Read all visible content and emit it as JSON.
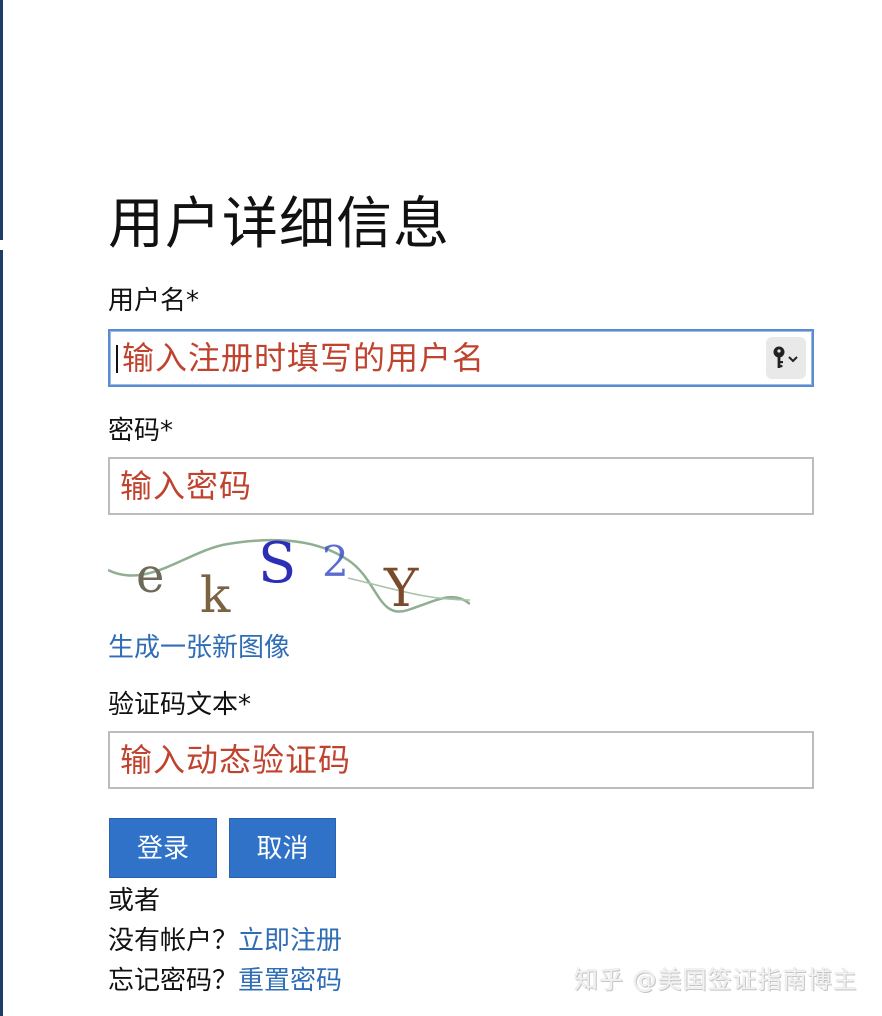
{
  "form": {
    "title": "用户详细信息",
    "username": {
      "label": "用户名*",
      "placeholder": "输入注册时填写的用户名"
    },
    "password": {
      "label": "密码*",
      "placeholder": "输入密码"
    },
    "captcha": {
      "image_text": [
        "e",
        "k",
        "S",
        "2",
        "Y"
      ],
      "refresh_link": "生成一张新图像",
      "label": "验证码文本*",
      "placeholder": "输入动态验证码"
    },
    "buttons": {
      "login": "登录",
      "cancel": "取消"
    },
    "or_text": "或者",
    "register": {
      "prompt": "没有帐户？",
      "link": "立即注册"
    },
    "reset": {
      "prompt": "忘记密码？",
      "link": "重置密码"
    }
  },
  "watermark": "知乎 @美国签证指南博主",
  "icons": {
    "password_manager": "key-icon",
    "dropdown": "chevron-down-icon"
  },
  "colors": {
    "placeholder": "#c0432f",
    "link": "#2f6db5",
    "button": "#2f72c8",
    "focus_border": "#5b8bd0"
  }
}
